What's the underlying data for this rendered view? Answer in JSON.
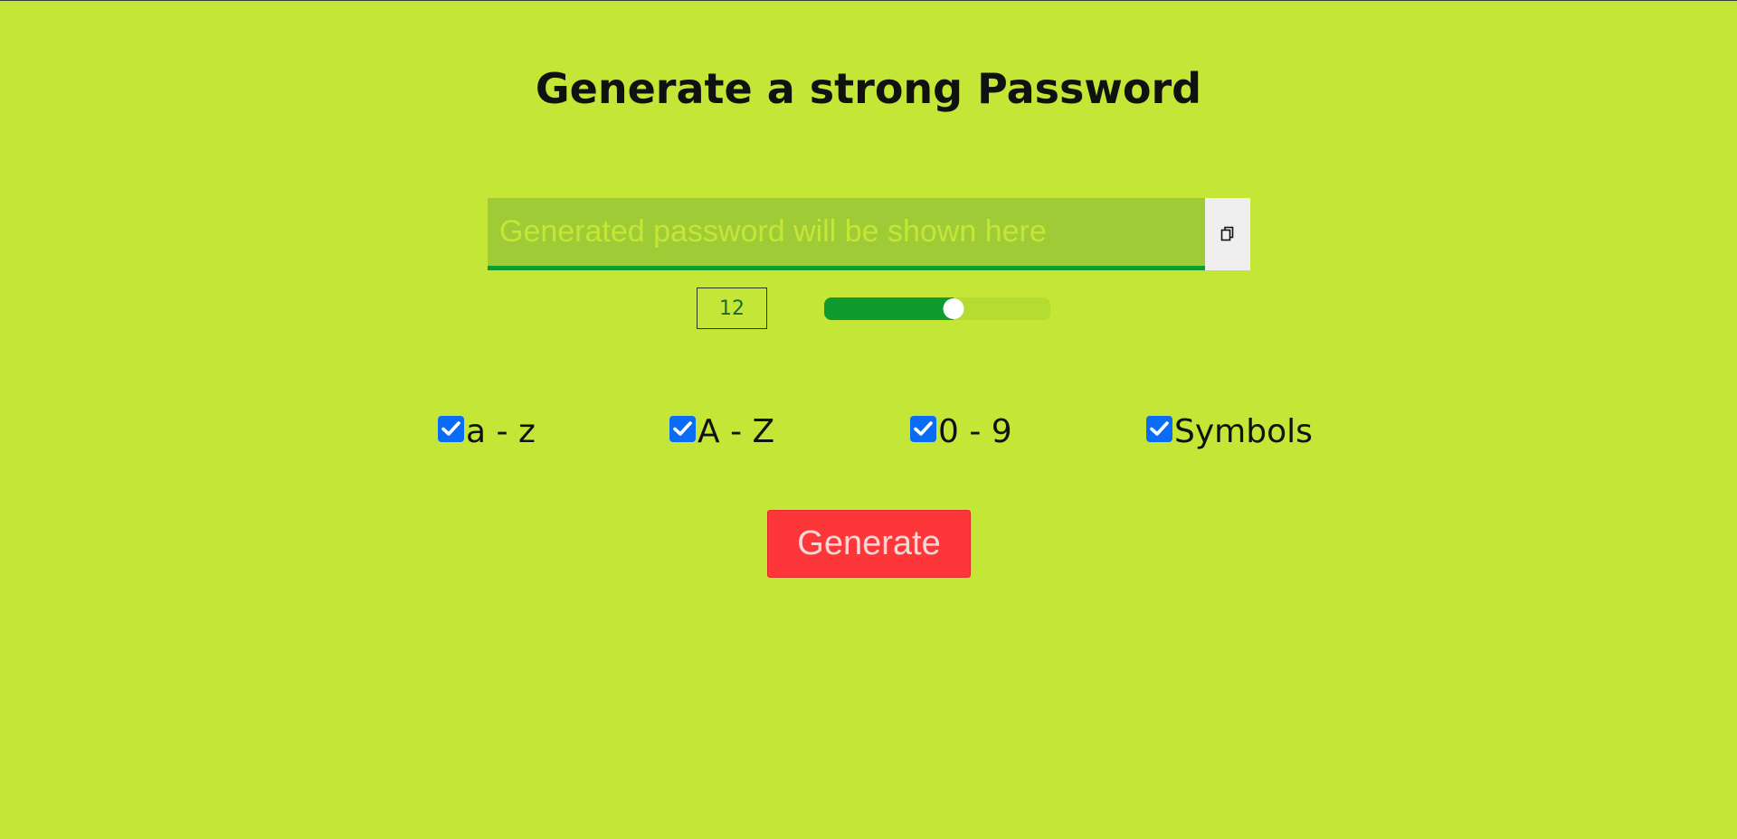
{
  "page": {
    "title": "Generate a strong Password"
  },
  "password": {
    "value": "",
    "placeholder": "Generated password will be shown here",
    "copy_icon": "copy-icon"
  },
  "length": {
    "value": "12",
    "slider_fraction": 0.57
  },
  "options": [
    {
      "label": "a - z",
      "checked": true
    },
    {
      "label": "A - Z",
      "checked": true
    },
    {
      "label": "0 - 9",
      "checked": true
    },
    {
      "label": "Symbols",
      "checked": true
    }
  ],
  "generate_button": {
    "label": "Generate"
  },
  "colors": {
    "background": "#c4e637",
    "accent": "#0f9b2e",
    "button": "#fd3739",
    "checkbox": "#0a6cf5"
  }
}
